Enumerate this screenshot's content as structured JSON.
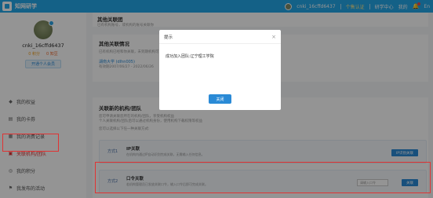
{
  "header": {
    "app_title": "知网研学",
    "username": "cnki_16cffd6437",
    "links": [
      "个售认证",
      "研学中心",
      "我的"
    ],
    "lang": "En"
  },
  "sidebar": {
    "username": "cnki_16cffd6437",
    "stat_1": "0 积分",
    "stat_2": "0 知豆",
    "open_btn": "开通个人会员",
    "items": [
      {
        "label": "我的权益"
      },
      {
        "label": "我的卡券"
      },
      {
        "label": "我的消费记录"
      },
      {
        "label": "关联机构/团队"
      },
      {
        "label": "我的积分"
      },
      {
        "label": "我发布的活动"
      }
    ]
  },
  "main": {
    "card_a_title": "其他关联团",
    "card_a_desc": "已有机构账号，或机构的账号关联你",
    "card_b_title": "其他关联情况",
    "card_b_desc": "已有机构已经和你关联，未到期机构可见以下信息，到期后自动解除关联情况。",
    "card_b_uni": "湖南大学 (dlhn005)",
    "card_b_period": "有效期2007/06/27 - 2022/06/26",
    "card_c_title": "关联新的机构/团队",
    "card_c_desc_1": "您可申请关联您所在的机构/团队，享受机构权益",
    "card_c_desc_2": "个人关联机构/团队后可以通过机构身份，使用机构下载权限等权益",
    "card_c_desc_3": "您可以选择以下任一种关联方式:",
    "method_1_tag": "方式1",
    "method_1_name": "IP关联",
    "method_1_desc": "在机构内通过IP自动识别完成关联，无需输入任何信息。",
    "method_1_btn": "IP识别关联",
    "method_2_tag": "方式2",
    "method_2_name": "口令关联",
    "method_2_desc": "若机构管理员已发放关联口令，输入口令后即可完成关联。",
    "method_2_input": "请输入口令",
    "method_2_btn": "关联"
  },
  "modal": {
    "title": "提示",
    "message": "成功加入团队:辽宁理工学院",
    "ok": "关闭"
  }
}
